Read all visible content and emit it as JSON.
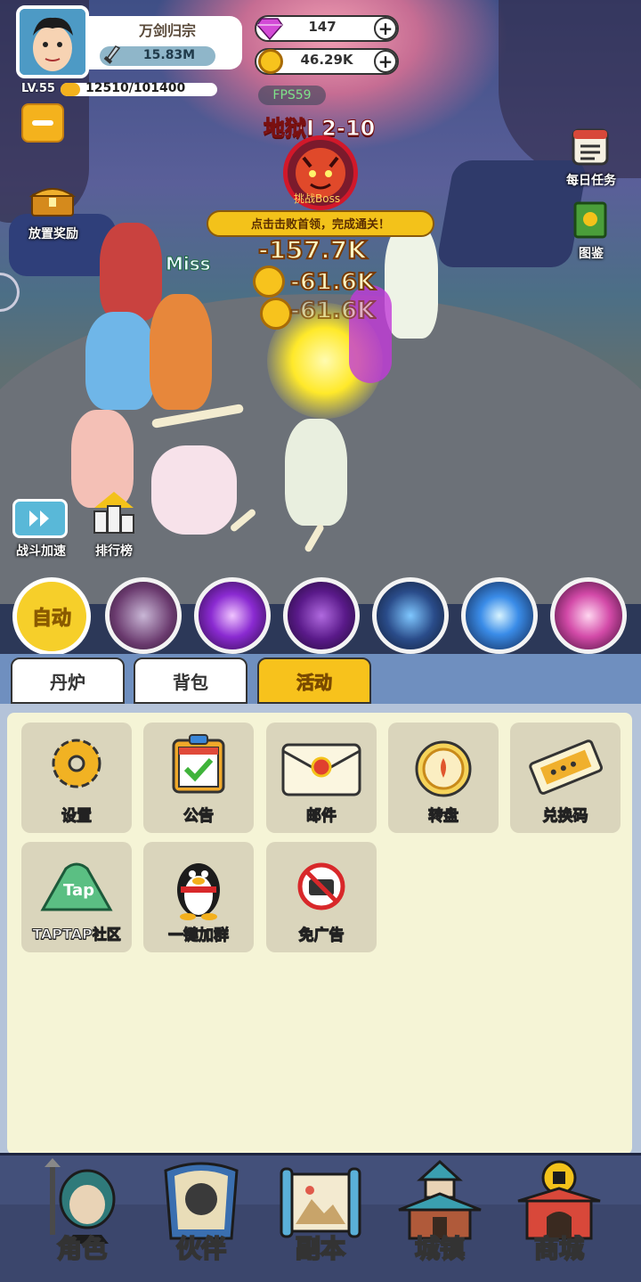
{
  "profile": {
    "name": "万剑归宗",
    "power": "15.83M",
    "level": "LV.55",
    "xp": "12510/101400",
    "xp_progress": 0.1234
  },
  "currency": {
    "gems": "147",
    "coins": "46.29K",
    "gems_icon": "gem-icon",
    "coins_icon": "coin-icon"
  },
  "battle": {
    "fps": "FPS59",
    "stage": "地狱I 2-10",
    "boss_label": "挑战Boss",
    "boss_hint": "点击击败首领，完成通关！",
    "damage_numbers": [
      "-157.7K",
      "-61.6K",
      "-61.6K"
    ],
    "miss": "Miss"
  },
  "side_buttons": {
    "idle_reward": "放置奖励",
    "daily_tasks": "每日任务",
    "codex": "图鉴",
    "battle_speed": "战斗加速",
    "ranking": "排行榜"
  },
  "auto_button": "自动",
  "skills": [
    "beast-skill-icon",
    "purple-orb-skill-icon",
    "vortex-skill-icon",
    "lightning-scroll-skill-icon",
    "blue-flame-skill-icon",
    "pink-spiral-skill-icon"
  ],
  "tabs": [
    "丹炉",
    "背包",
    "活动"
  ],
  "active_tab": "活动",
  "activity_items": [
    {
      "label": "设置",
      "icon": "gear-icon"
    },
    {
      "label": "公告",
      "icon": "clipboard-icon"
    },
    {
      "label": "邮件",
      "icon": "mail-icon"
    },
    {
      "label": "转盘",
      "icon": "wheel-icon"
    },
    {
      "label": "兑换码",
      "icon": "ticket-icon"
    },
    {
      "label": "TAPTAP社区",
      "icon": "taptap-icon"
    },
    {
      "label": "一键加群",
      "icon": "penguin-icon"
    },
    {
      "label": "免广告",
      "icon": "no-ads-icon"
    }
  ],
  "bottom_nav": [
    {
      "label": "角色",
      "icon": "character-icon"
    },
    {
      "label": "伙伴",
      "icon": "partner-icon"
    },
    {
      "label": "副本",
      "icon": "dungeon-icon"
    },
    {
      "label": "城镇",
      "icon": "town-icon"
    },
    {
      "label": "商城",
      "icon": "shop-icon"
    }
  ],
  "colors": {
    "accent": "#f4b21d",
    "boss_red": "#d1182a",
    "panel_bg": "#f5f4d6",
    "nav_bg": "#43507a"
  }
}
